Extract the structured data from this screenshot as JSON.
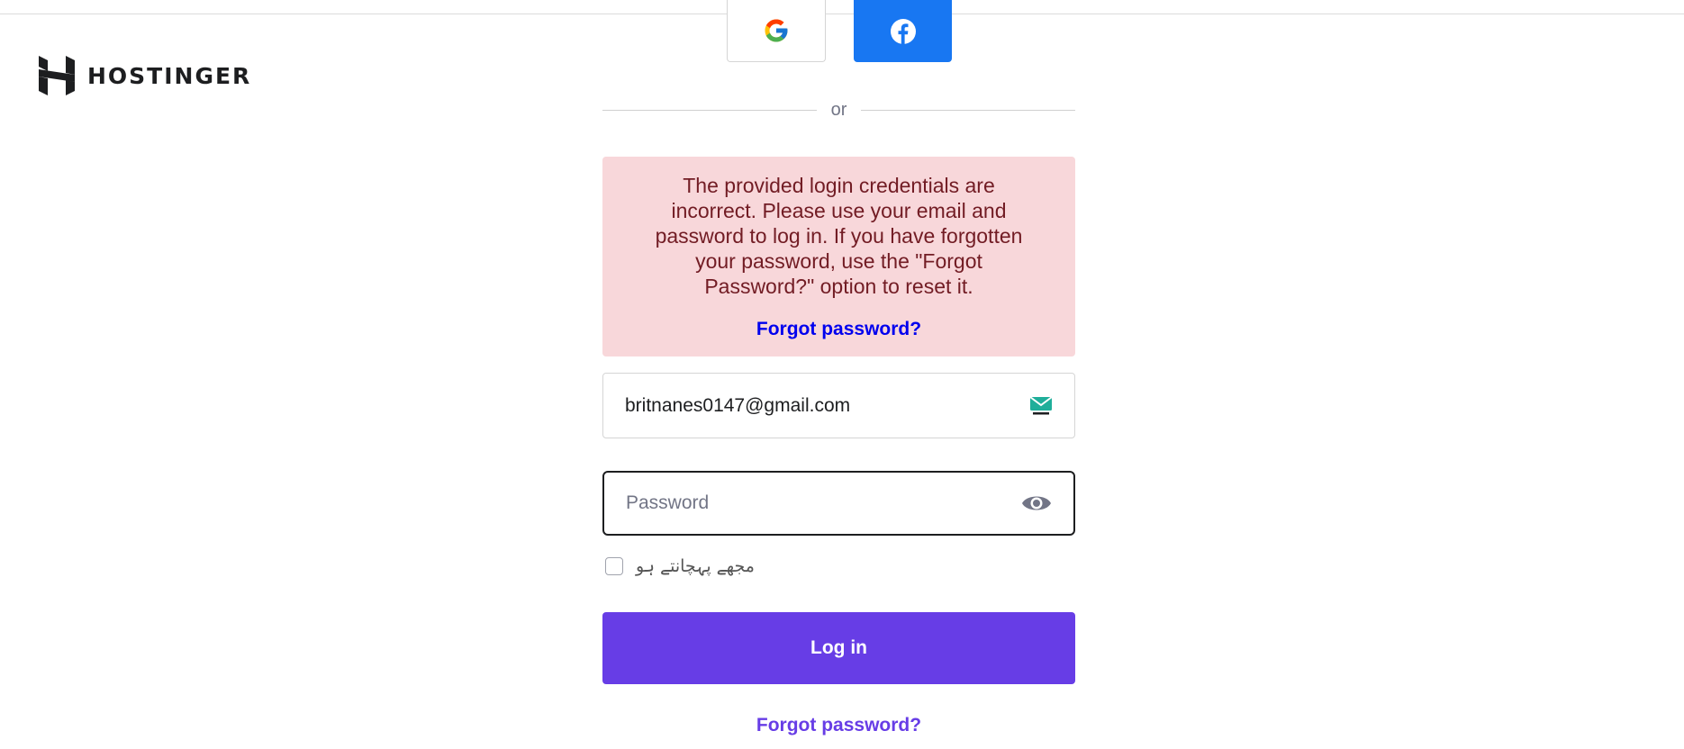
{
  "brand": {
    "name": "HOSTINGER",
    "logo_icon": "hostinger-h-logo"
  },
  "social": {
    "google_icon": "google-g-icon",
    "facebook_icon": "facebook-f-icon",
    "facebook_color": "#1877f2"
  },
  "divider": {
    "text": "or"
  },
  "alert": {
    "message": "The provided login credentials are incorrect. Please use your email and password to log in. If you have forgotten your password, use the \"Forgot Password?\" option to reset it.",
    "link_label": "Forgot password?",
    "background_color": "#f8d7da",
    "text_color": "#721c24"
  },
  "form": {
    "email_value": "britnanes0147@gmail.com",
    "email_icon": "temp-mail-icon",
    "password_value": "",
    "password_placeholder": "Password",
    "password_toggle_icon": "eye-icon",
    "remember_label": "مجھے پہچانتے ہو",
    "remember_checked": false,
    "submit_label": "Log in",
    "submit_color": "#673de6"
  },
  "footer": {
    "forgot_label": "Forgot password?"
  }
}
